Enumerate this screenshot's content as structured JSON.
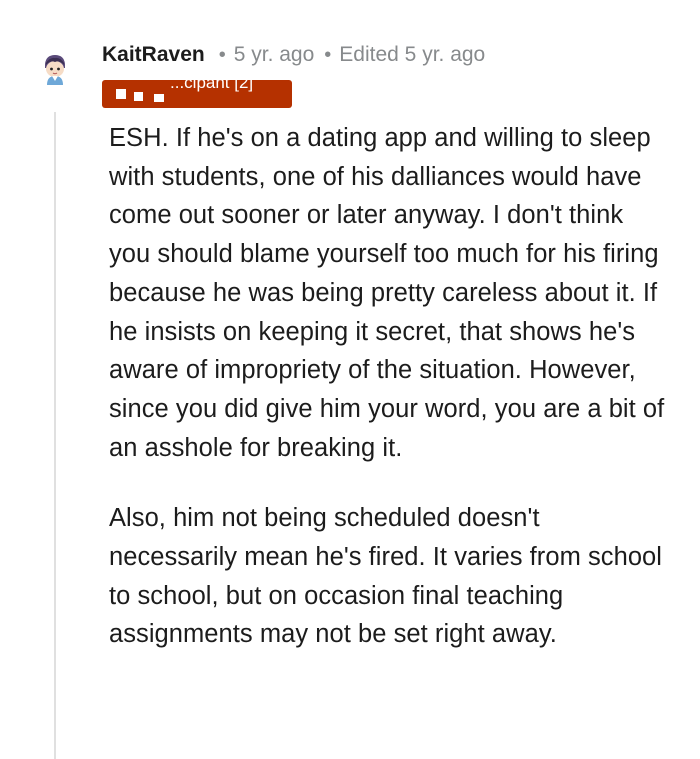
{
  "comment": {
    "username": "KaitRaven",
    "separator": "•",
    "time_ago": "5 yr. ago",
    "edited": "Edited 5 yr. ago",
    "flair": "...cipant [2]",
    "paragraphs": [
      "ESH. If he's on a dating app and willing to sleep with students, one of his dalliances would have come out sooner or later anyway. I don't think you should blame yourself too much for his firing because he was being pretty careless about it. If he insists on keeping it secret, that shows he's aware of impropriety of the situation. However, since you did give him your word, you are a bit of an asshole for breaking it.",
      "Also, him not being scheduled doesn't necessarily mean he's fired. It varies from school to school, but on occasion final teaching assignments may not be set right away."
    ]
  },
  "colors": {
    "flair_background": "#b53100",
    "meta_text": "#878a8c",
    "body_text": "#1c1c1c",
    "thread_line": "#e0e0e0"
  },
  "icons": {
    "avatar": "snoo-avatar-icon"
  }
}
